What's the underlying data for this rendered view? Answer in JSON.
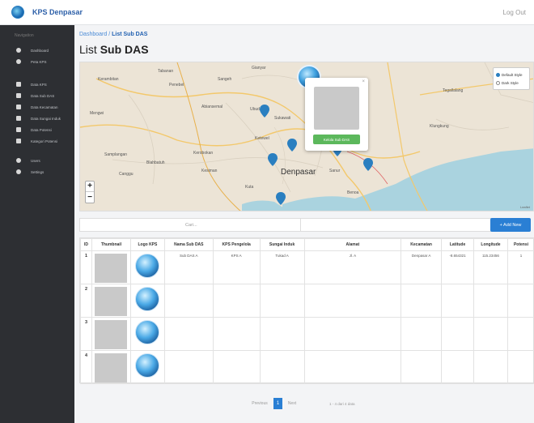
{
  "brand": {
    "name": "KPS Denpasar"
  },
  "topbar": {
    "user": "Log Out"
  },
  "sidebar": {
    "section": "Navigation",
    "items": [
      {
        "label": "Dashboard",
        "icon": "home-icon"
      },
      {
        "label": "Peta KPS",
        "icon": "map-pin-icon"
      },
      {
        "label": "Data KPS",
        "icon": "list-icon"
      },
      {
        "label": "Data Sub DAS",
        "icon": "list-icon"
      },
      {
        "label": "Data Kecamatan",
        "icon": "list-icon"
      },
      {
        "label": "Data Sungai Induk",
        "icon": "list-icon"
      },
      {
        "label": "Data Potensi",
        "icon": "list-icon"
      },
      {
        "label": "Kategori Potensi",
        "icon": "list-icon"
      },
      {
        "label": "Users",
        "icon": "user-icon"
      },
      {
        "label": "Settings",
        "icon": "settings-icon"
      }
    ]
  },
  "breadcrumb": {
    "home": "Dashboard",
    "separator": "/",
    "current": "List Sub DAS"
  },
  "page": {
    "title_prefix": "List",
    "title_bold": "Sub DAS"
  },
  "map": {
    "labels": {
      "gianyar": "Gianyar",
      "tabanan": "Tabanan",
      "sangeh": "Sangeh",
      "mengwi": "Mengwi",
      "ubud": "Ubud",
      "abiansemal": "Abiansemal",
      "penebel": "Penebel",
      "kerambitan": "Kerambitan",
      "sukawati": "Sukawati",
      "canggu": "Canggu",
      "kerobokan": "Kerobokan",
      "denpasar": "Denpasar",
      "sanur": "Sanur",
      "kuta": "Kuta",
      "kesiman": "Kesiman",
      "benoa": "Benoa",
      "tegallalang": "Tegallalang",
      "blahbatuh": "Blahbatuh",
      "klungkung": "Klungkung",
      "samplangan": "Samplangan",
      "ketewel": "Ketewel"
    },
    "layers": {
      "default": "Default Style",
      "dark": "Dark Style"
    },
    "popup": {
      "button": "Kelola Sub DAS"
    },
    "attribution": "Leaflet",
    "marker_color": "#2a7fc0"
  },
  "search": {
    "placeholder": "Cari..."
  },
  "add_button": "+ Add New",
  "table": {
    "columns": [
      "ID",
      "Thumbnail",
      "Logo KPS",
      "Nama Sub DAS",
      "KPS Pengelola",
      "Sungai Induk",
      "Alamat",
      "Kecamatan",
      "Latitude",
      "Longitude",
      "Potensi"
    ],
    "rows": [
      {
        "id": "1",
        "nama": "Sub DAS A",
        "kps": "KPS A",
        "sungai": "Tukad A",
        "alamat": "Jl. A",
        "kecamatan": "Denpasar A",
        "lat": "-8.654321",
        "lng": "115.23456",
        "potensi": "1"
      },
      {
        "id": "2",
        "nama": "",
        "kps": "",
        "sungai": "",
        "alamat": "",
        "kecamatan": "",
        "lat": "",
        "lng": "",
        "potensi": ""
      },
      {
        "id": "3",
        "nama": "",
        "kps": "",
        "sungai": "",
        "alamat": "",
        "kecamatan": "",
        "lat": "",
        "lng": "",
        "potensi": ""
      },
      {
        "id": "4",
        "nama": "",
        "kps": "",
        "sungai": "",
        "alamat": "",
        "kecamatan": "",
        "lat": "",
        "lng": "",
        "potensi": ""
      }
    ]
  },
  "pagination": {
    "prev": "Previous",
    "current": "1",
    "next": "Next",
    "info": "1 - 4 dari 4 data"
  }
}
